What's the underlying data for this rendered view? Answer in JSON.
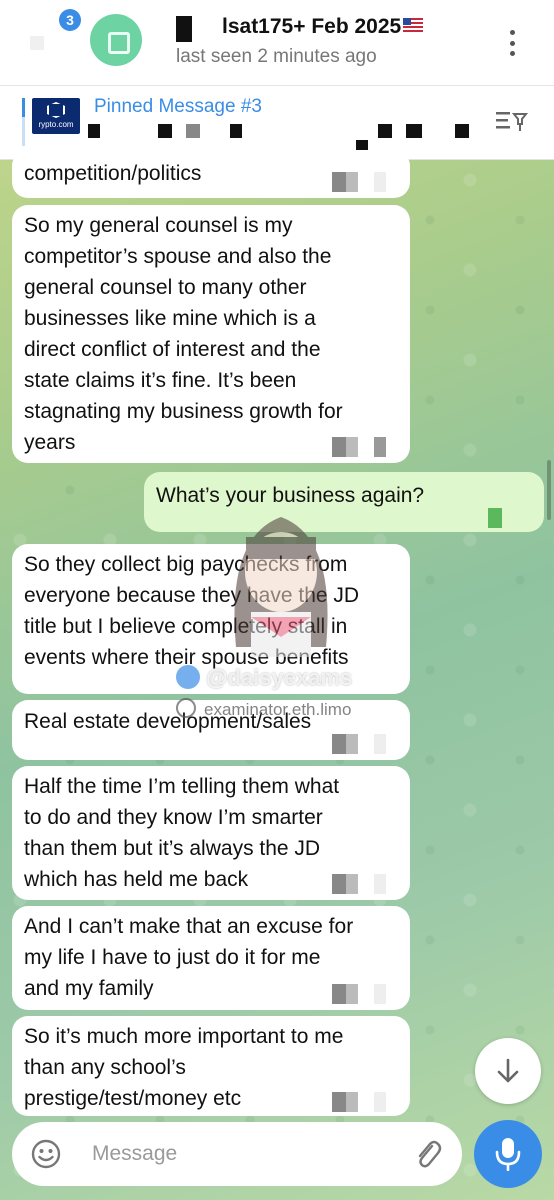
{
  "header": {
    "unread_count": "3",
    "title": "lsat175+ Feb 2025",
    "subtitle": "last seen 2 minutes ago"
  },
  "pinned": {
    "label": "Pinned Message #3",
    "thumb_text": "rypto.com"
  },
  "messages": [
    {
      "direction": "in",
      "text": "competition/politics"
    },
    {
      "direction": "in",
      "text": "So my general counsel is my\ncompetitor’s spouse and also the\ngeneral counsel to many other\nbusinesses like mine which is a\ndirect conflict of interest and the\nstate claims it’s fine. It’s been\nstagnating my business growth for\nyears"
    },
    {
      "direction": "out",
      "text": "What’s your business again?"
    },
    {
      "direction": "in",
      "text": "So they collect big paychecks from\neveryone because they have the JD\ntitle but I believe completely stall in\nevents where their spouse benefits"
    },
    {
      "direction": "in",
      "text": "Real estate development/sales"
    },
    {
      "direction": "in",
      "text": "Half the time I’m telling them what\nto do and they know I’m smarter\nthan them but it’s always the JD\nwhich has held me back"
    },
    {
      "direction": "in",
      "text": "And I can’t make that an excuse for\nmy life I have to just do it for me\nand my family"
    },
    {
      "direction": "in",
      "text": "So it’s much more important to me\nthan any school’s\nprestige/test/money etc"
    }
  ],
  "watermark": {
    "handle": "@daisyexams",
    "url": "examinator.eth.limo"
  },
  "composer": {
    "placeholder": "Message"
  },
  "colors": {
    "accent": "#3a8de6",
    "incoming_bubble": "#ffffff",
    "outgoing_bubble": "#dff7cc"
  }
}
